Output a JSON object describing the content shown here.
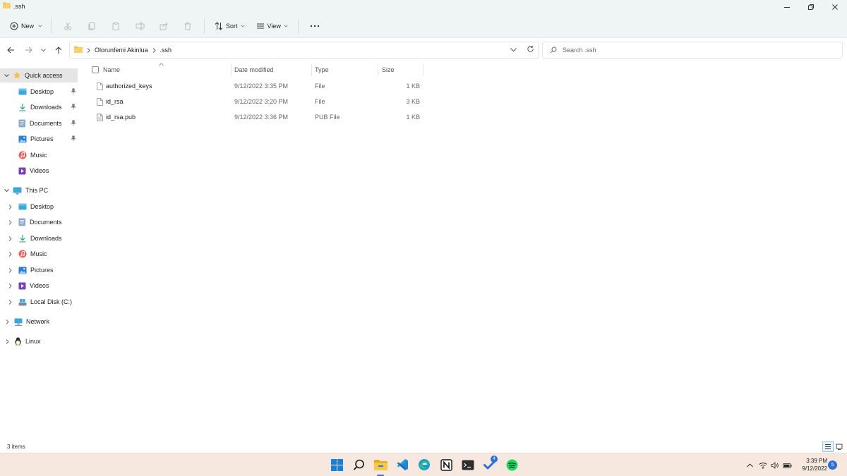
{
  "window": {
    "title": ".ssh"
  },
  "toolbar": {
    "new_label": "New",
    "sort_label": "Sort",
    "view_label": "View"
  },
  "address": {
    "crumbs": [
      "Olorunfemi Akinlua",
      ".ssh"
    ]
  },
  "search": {
    "placeholder": "Search .ssh"
  },
  "sidebar": {
    "quick_access": {
      "label": "Quick access",
      "items": [
        {
          "label": "Desktop",
          "icon": "desktop-icon",
          "pinned": true
        },
        {
          "label": "Downloads",
          "icon": "downloads-icon",
          "pinned": true
        },
        {
          "label": "Documents",
          "icon": "documents-icon",
          "pinned": true
        },
        {
          "label": "Pictures",
          "icon": "pictures-icon",
          "pinned": true
        },
        {
          "label": "Music",
          "icon": "music-icon",
          "pinned": false
        },
        {
          "label": "Videos",
          "icon": "videos-icon",
          "pinned": false
        }
      ]
    },
    "this_pc": {
      "label": "This PC",
      "items": [
        {
          "label": "Desktop",
          "icon": "desktop-icon"
        },
        {
          "label": "Documents",
          "icon": "documents-icon"
        },
        {
          "label": "Downloads",
          "icon": "downloads-icon"
        },
        {
          "label": "Music",
          "icon": "music-icon"
        },
        {
          "label": "Pictures",
          "icon": "pictures-icon"
        },
        {
          "label": "Videos",
          "icon": "videos-icon"
        },
        {
          "label": "Local Disk (C:)",
          "icon": "drive-icon"
        }
      ]
    },
    "network": {
      "label": "Network"
    },
    "linux": {
      "label": "Linux"
    }
  },
  "columns": {
    "name": "Name",
    "date": "Date modified",
    "type": "Type",
    "size": "Size"
  },
  "files": [
    {
      "name": "authorized_keys",
      "date": "9/12/2022 3:35 PM",
      "type": "File",
      "size": "1 KB"
    },
    {
      "name": "id_rsa",
      "date": "9/12/2022 3:20 PM",
      "type": "File",
      "size": "3 KB"
    },
    {
      "name": "id_rsa.pub",
      "date": "9/12/2022 3:36 PM",
      "type": "PUB File",
      "size": "1 KB"
    }
  ],
  "status": {
    "item_count": "3 items"
  },
  "taskbar": {
    "time": "3:39 PM",
    "date": "9/12/2022",
    "notifications": "5",
    "app_badge": "4"
  },
  "colors": {
    "accent": "#0067c0",
    "folder": "#f5c342",
    "taskbar": "#f6e8de",
    "chrome": "#eef5f4"
  }
}
